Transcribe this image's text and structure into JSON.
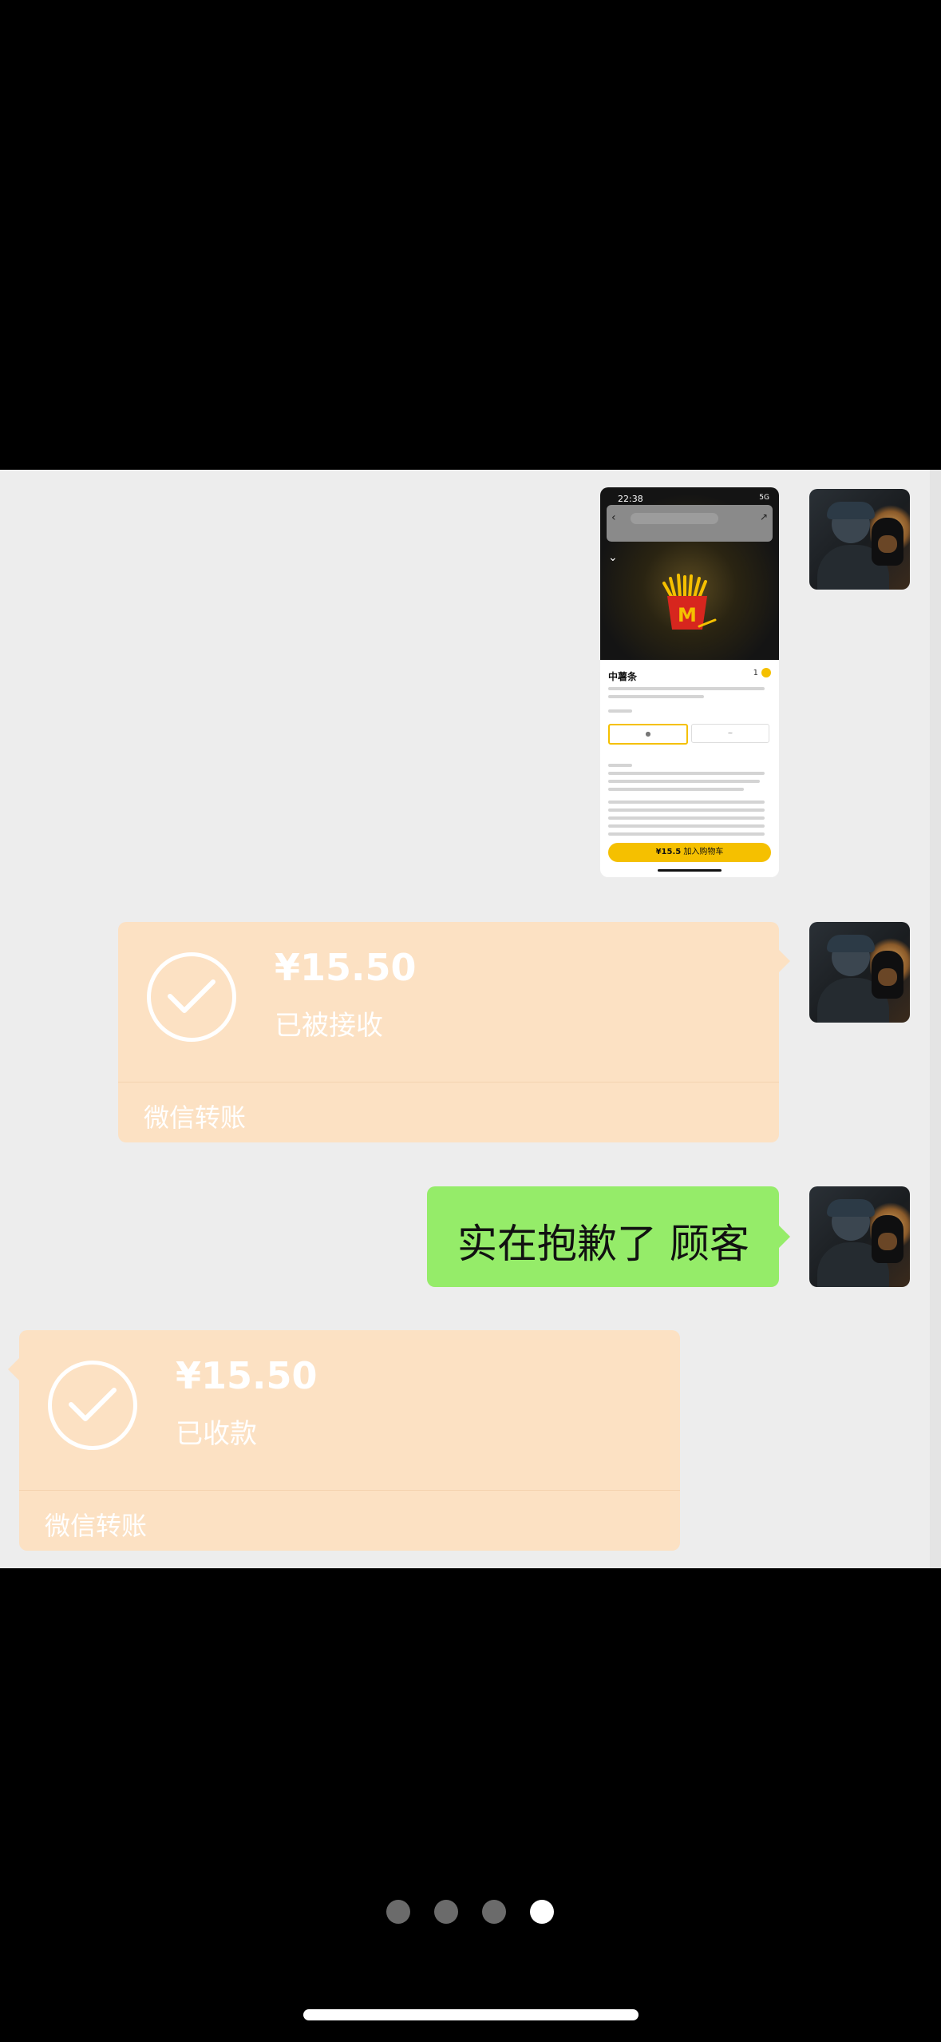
{
  "screenshot": {
    "status_time": "22:38",
    "status_right": "5G",
    "product_title": "中薯条",
    "product_qty": "1",
    "price": "¥15.5",
    "add_to_cart": "加入购物车"
  },
  "transfer_sent": {
    "amount": "¥15.50",
    "status": "已被接收",
    "footer": "微信转账"
  },
  "message_text": "实在抱歉了 顾客",
  "transfer_received": {
    "amount": "¥15.50",
    "status": "已收款",
    "footer": "微信转账"
  },
  "page_indicator": {
    "count": 4,
    "active_index": 3
  },
  "colors": {
    "chat_bg": "#ededed",
    "transfer_bubble": "#fce1c3",
    "message_bubble": "#95ec69",
    "outer_bg": "#000000"
  }
}
